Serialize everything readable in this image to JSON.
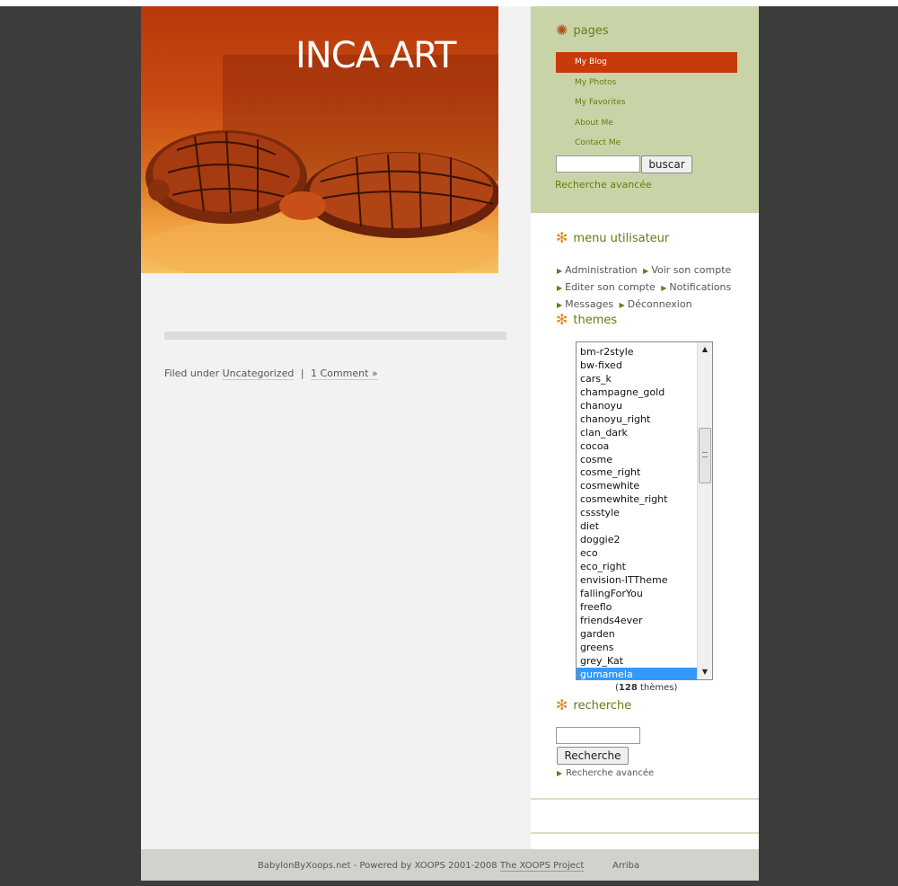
{
  "header": {
    "title": "INCA ART"
  },
  "post": {
    "filed_under_label": "Filed under",
    "category": "Uncategorized",
    "separator": "|",
    "comments": "1 Comment »"
  },
  "pages": {
    "title": "pages",
    "items": [
      {
        "label": "My Blog"
      },
      {
        "label": "My Photos"
      },
      {
        "label": "My Favorites"
      },
      {
        "label": "About Me"
      },
      {
        "label": "Contact Me"
      }
    ],
    "search_button": "buscar",
    "advanced_search": "Recherche avancée"
  },
  "user_menu": {
    "title": "menu utilisateur",
    "items": [
      "Administration",
      "Voir son compte",
      "Editer son compte",
      "Notifications",
      "Messages",
      "Déconnexion"
    ]
  },
  "themes": {
    "title": "themes",
    "items": [
      "bm-r2style",
      "bw-fixed",
      "cars_k",
      "champagne_gold",
      "chanoyu",
      "chanoyu_right",
      "clan_dark",
      "cocoa",
      "cosme",
      "cosme_right",
      "cosmewhite",
      "cosmewhite_right",
      "cssstyle",
      "diet",
      "doggie2",
      "eco",
      "eco_right",
      "envision-ITTheme",
      "fallingForYou",
      "freeflo",
      "friends4ever",
      "garden",
      "greens",
      "grey_Kat",
      "gumamela"
    ],
    "selected": "gumamela",
    "count": "128",
    "count_suffix": "thèmes)",
    "count_prefix": "("
  },
  "recherche": {
    "title": "recherche",
    "button": "Recherche",
    "advanced": "Recherche avancée"
  },
  "footer": {
    "text": "BabylonByXoops.net - Powered by XOOPS 2001-2008",
    "link": "The XOOPS Project",
    "top_link": "Arriba"
  },
  "colors": {
    "accent_red": "#c83a0a",
    "sidebar_green": "#c8d4a8",
    "title_green": "#6a7a10",
    "star_orange": "#e08820"
  }
}
